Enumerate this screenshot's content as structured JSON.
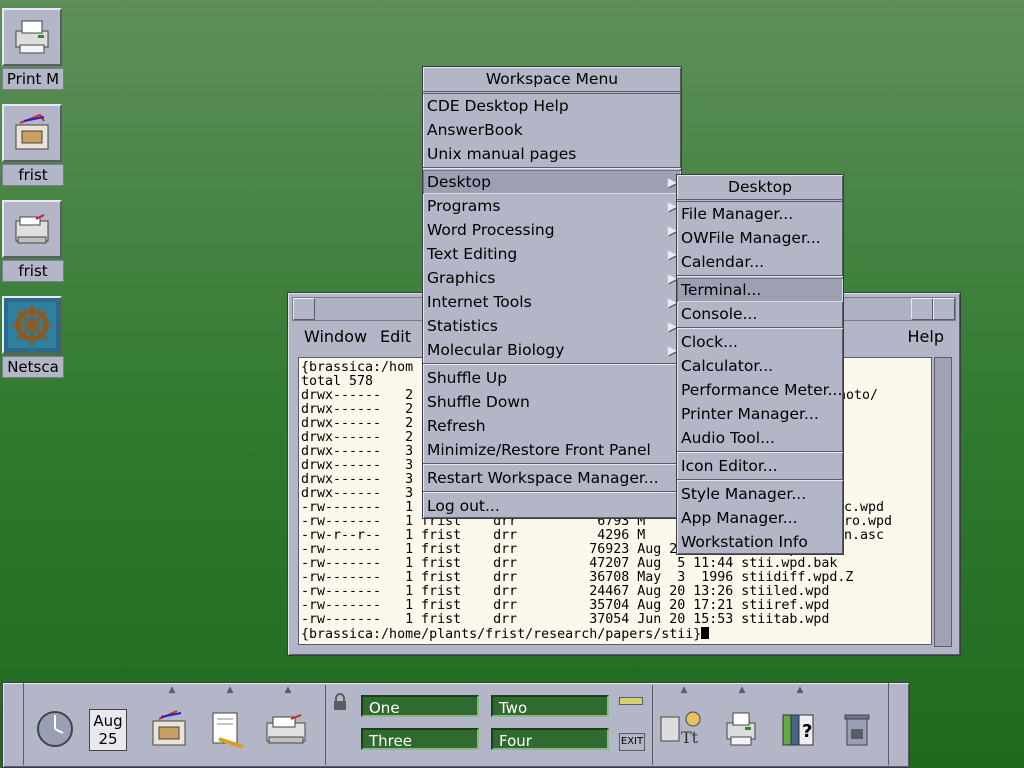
{
  "desktop": {
    "icons": [
      {
        "label": "Print M"
      },
      {
        "label": "frist"
      },
      {
        "label": "frist"
      },
      {
        "label": "Netsca"
      }
    ]
  },
  "terminal": {
    "menu": {
      "window": "Window",
      "edit": "Edit",
      "help": "Help"
    },
    "lines": [
      "{brassica:/hom",
      "total 578",
      "drwx------   2",
      "drwx------   2",
      "drwx------   2",
      "drwx------   2",
      "drwx------   3",
      "drwx------   3",
      "drwx------   3",
      "drwx------   3",
      "-rw-------   1",
      "-rw-------   1 frist    drr          6793 M",
      "-rw-r--r--   1 frist    drr          4296 M",
      "-rw-------   1 frist    drr         76923 Aug 20 17:16 stii.wpd",
      "-rw-------   1 frist    drr         47207 Aug  5 11:44 stii.wpd.bak",
      "-rw-------   1 frist    drr         36708 May  3  1996 stiidiff.wpd.Z",
      "-rw-------   1 frist    drr         24467 Aug 20 13:26 stiiled.wpd",
      "-rw-------   1 frist    drr         35704 Aug 20 17:21 stiiref.wpd",
      "-rw-------   1 frist    drr         37054 Jun 20 15:53 stiitab.wpd",
      "{brassica:/home/plants/frist/research/papers/stii}"
    ],
    "right_fragments": [
      "hoto/",
      "c.wpd",
      "ro.wpd",
      "n.asc"
    ]
  },
  "workspace_menu": {
    "title": "Workspace Menu",
    "groups": [
      [
        {
          "label": "CDE Desktop Help"
        },
        {
          "label": "AnswerBook"
        },
        {
          "label": "Unix manual pages"
        }
      ],
      [
        {
          "label": "Desktop",
          "submenu": true,
          "selected": true
        },
        {
          "label": "Programs",
          "submenu": true
        },
        {
          "label": "Word Processing",
          "submenu": true
        },
        {
          "label": "Text Editing",
          "submenu": true
        },
        {
          "label": "Graphics",
          "submenu": true
        },
        {
          "label": "Internet Tools",
          "submenu": true
        },
        {
          "label": "Statistics",
          "submenu": true
        },
        {
          "label": "Molecular Biology",
          "submenu": true
        }
      ],
      [
        {
          "label": "Shuffle Up"
        },
        {
          "label": "Shuffle Down"
        },
        {
          "label": "Refresh"
        },
        {
          "label": "Minimize/Restore Front Panel"
        }
      ],
      [
        {
          "label": "Restart Workspace Manager..."
        }
      ],
      [
        {
          "label": "Log out..."
        }
      ]
    ]
  },
  "desktop_menu": {
    "title": "Desktop",
    "groups": [
      [
        {
          "label": "File Manager..."
        },
        {
          "label": "OWFile Manager..."
        },
        {
          "label": "Calendar..."
        }
      ],
      [
        {
          "label": "Terminal...",
          "selected": true
        },
        {
          "label": "Console..."
        }
      ],
      [
        {
          "label": "Clock..."
        },
        {
          "label": "Calculator..."
        },
        {
          "label": "Performance Meter..."
        },
        {
          "label": "Printer Manager..."
        },
        {
          "label": "Audio Tool..."
        }
      ],
      [
        {
          "label": "Icon Editor..."
        }
      ],
      [
        {
          "label": "Style Manager..."
        },
        {
          "label": "App Manager..."
        },
        {
          "label": "Workstation Info"
        }
      ]
    ]
  },
  "front_panel": {
    "calendar": {
      "month": "Aug",
      "day": "25"
    },
    "workspaces": [
      "One",
      "Two",
      "Three",
      "Four"
    ],
    "exit_label": "EXIT",
    "icons": [
      "clock-icon",
      "calendar-icon",
      "file-manager-icon",
      "text-editor-icon",
      "mailer-icon",
      "lock-icon",
      "busy-light-icon",
      "exit-icon",
      "personal-apps-icon",
      "printer-icon",
      "help-manual-icon",
      "trash-icon"
    ]
  }
}
